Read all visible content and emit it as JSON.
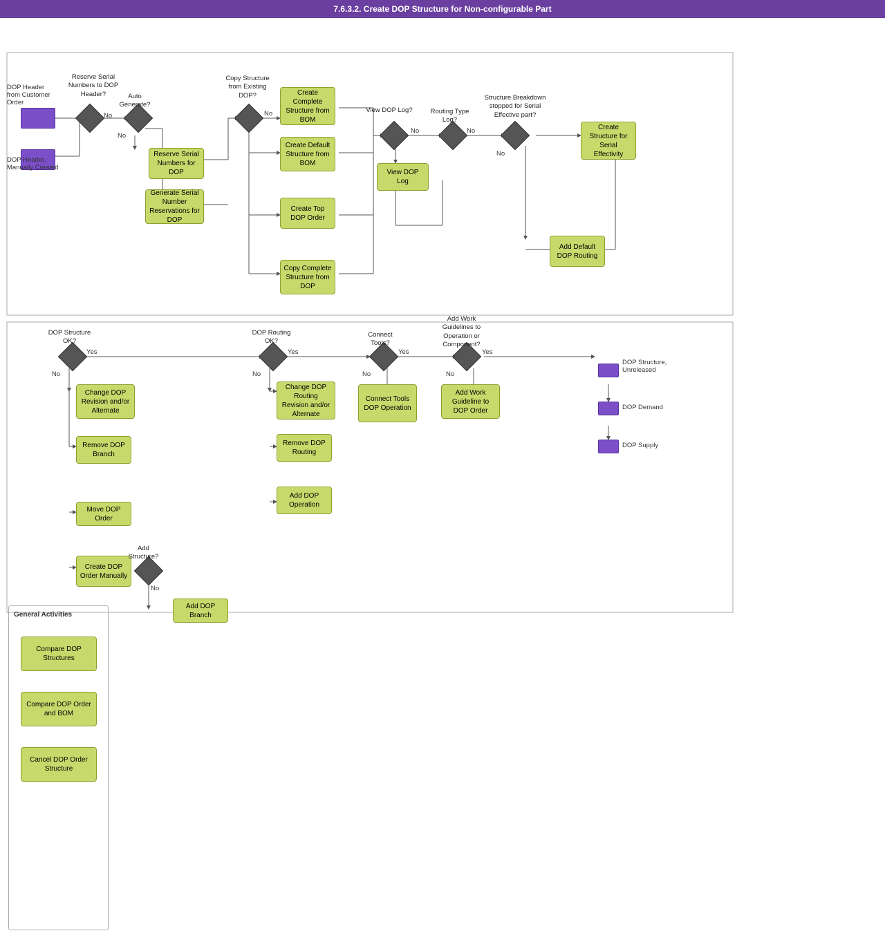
{
  "title": "7.6.3.2. Create DOP Structure for Non-configurable Part",
  "nodes": {
    "dop_header_customer": {
      "label": "DOP Header from Customer Order"
    },
    "dop_header_manual": {
      "label": "DOP Header, Manually Created"
    },
    "reserve_serial_q": {
      "label": "Reserve Serial Numbers to DOP Header?"
    },
    "auto_generate_q": {
      "label": "Auto Generate?"
    },
    "reserve_serial_dop": {
      "label": "Reserve Serial Numbers for DOP"
    },
    "generate_serial_res": {
      "label": "Generate Serial Number Reservations for DOP"
    },
    "copy_structure_q": {
      "label": "Copy Structure from Existing DOP?"
    },
    "create_complete_bom": {
      "label": "Create Complete Structure from BOM"
    },
    "create_default_bom": {
      "label": "Create Default Structure from BOM"
    },
    "create_top_dop": {
      "label": "Create Top DOP Order"
    },
    "copy_complete_dop": {
      "label": "Copy Complete Structure from DOP"
    },
    "view_dop_log_q": {
      "label": "View DOP Log?"
    },
    "view_dop_log": {
      "label": "View DOP Log"
    },
    "routing_type_q": {
      "label": "Routing Type Log?"
    },
    "structure_breakdown_q": {
      "label": "Structure Breakdown stopped for Serial Effective part?"
    },
    "create_structure_serial": {
      "label": "Create Structure for Serial Effectivity"
    },
    "add_default_routing": {
      "label": "Add Default DOP Routing"
    },
    "dop_structure_ok_q": {
      "label": "DOP Structure OK?"
    },
    "change_dop_rev": {
      "label": "Change DOP Revision and/or Alternate"
    },
    "remove_dop_branch": {
      "label": "Remove DOP Branch"
    },
    "move_dop_order": {
      "label": "Move DOP Order"
    },
    "create_dop_order_manually": {
      "label": "Create DOP Order Manually"
    },
    "add_structure_q": {
      "label": "Add Structure?"
    },
    "add_dop_branch": {
      "label": "Add DOP Branch"
    },
    "dop_routing_ok_q": {
      "label": "DOP Routing OK?"
    },
    "change_dop_routing": {
      "label": "Change DOP Routing Revision and/or Alternate"
    },
    "remove_dop_routing": {
      "label": "Remove DOP Routing"
    },
    "add_dop_operation": {
      "label": "Add DOP Operation"
    },
    "connect_tools_q": {
      "label": "Connect Tools?"
    },
    "connect_tools_dop": {
      "label": "Connect Tools DOP Operation"
    },
    "add_work_guidelines_q": {
      "label": "Add Work Guidelines to Operation or Component?"
    },
    "add_work_guideline": {
      "label": "Add Work Guideline to DOP Order"
    },
    "dop_structure_unreleased": {
      "label": "DOP Structure, Unreleased"
    },
    "dop_demand": {
      "label": "DOP Demand"
    },
    "dop_supply": {
      "label": "DOP Supply"
    },
    "general_activities": {
      "label": "General Activities"
    },
    "compare_dop_structures": {
      "label": "Compare DOP Structures"
    },
    "compare_dop_order_bom": {
      "label": "Compare DOP Order and BOM"
    },
    "cancel_dop_order": {
      "label": "Cancel DOP Order Structure"
    }
  },
  "labels": {
    "no": "No",
    "yes": "Yes"
  }
}
